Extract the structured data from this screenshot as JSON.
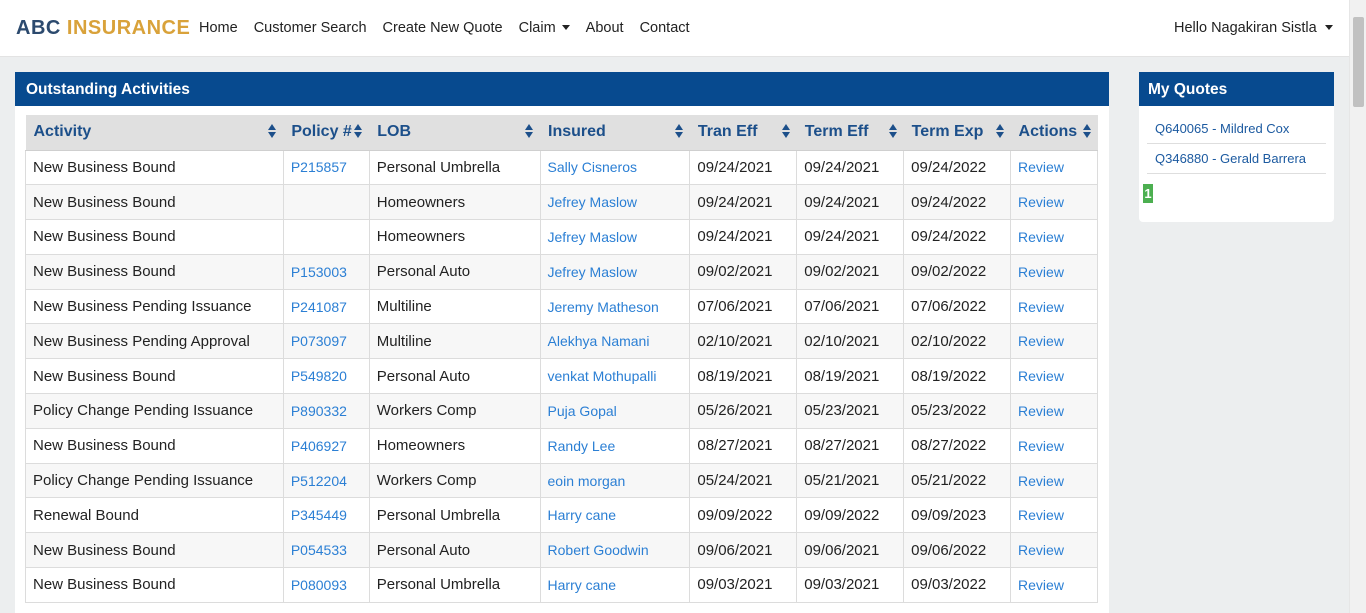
{
  "brand": {
    "part1": "ABC",
    "part2": "INSURANCE"
  },
  "nav": {
    "home": "Home",
    "customer_search": "Customer Search",
    "create_quote": "Create New Quote",
    "claim": "Claim",
    "about": "About",
    "contact": "Contact"
  },
  "user": {
    "greeting": "Hello Nagakiran Sistla"
  },
  "activities": {
    "title": "Outstanding Activities",
    "columns": [
      "Activity",
      "Policy #",
      "LOB",
      "Insured",
      "Tran Eff",
      "Term Eff",
      "Term Exp",
      "Actions"
    ],
    "rows": [
      {
        "activity": "New Business Bound",
        "policy": "P215857",
        "lob": "Personal Umbrella",
        "insured": "Sally Cisneros",
        "tran_eff": "09/24/2021",
        "term_eff": "09/24/2021",
        "term_exp": "09/24/2022",
        "action": "Review"
      },
      {
        "activity": "New Business Bound",
        "policy": "",
        "lob": "Homeowners",
        "insured": "Jefrey Maslow",
        "tran_eff": "09/24/2021",
        "term_eff": "09/24/2021",
        "term_exp": "09/24/2022",
        "action": "Review"
      },
      {
        "activity": "New Business Bound",
        "policy": "",
        "lob": "Homeowners",
        "insured": "Jefrey Maslow",
        "tran_eff": "09/24/2021",
        "term_eff": "09/24/2021",
        "term_exp": "09/24/2022",
        "action": "Review"
      },
      {
        "activity": "New Business Bound",
        "policy": "P153003",
        "lob": "Personal Auto",
        "insured": "Jefrey Maslow",
        "tran_eff": "09/02/2021",
        "term_eff": "09/02/2021",
        "term_exp": "09/02/2022",
        "action": "Review"
      },
      {
        "activity": "New Business Pending Issuance",
        "policy": "P241087",
        "lob": "Multiline",
        "insured": "Jeremy Matheson",
        "tran_eff": "07/06/2021",
        "term_eff": "07/06/2021",
        "term_exp": "07/06/2022",
        "action": "Review"
      },
      {
        "activity": "New Business Pending Approval",
        "policy": "P073097",
        "lob": "Multiline",
        "insured": "Alekhya Namani",
        "tran_eff": "02/10/2021",
        "term_eff": "02/10/2021",
        "term_exp": "02/10/2022",
        "action": "Review"
      },
      {
        "activity": "New Business Bound",
        "policy": "P549820",
        "lob": "Personal Auto",
        "insured": "venkat Mothupalli",
        "tran_eff": "08/19/2021",
        "term_eff": "08/19/2021",
        "term_exp": "08/19/2022",
        "action": "Review"
      },
      {
        "activity": "Policy Change Pending Issuance",
        "policy": "P890332",
        "lob": "Workers Comp",
        "insured": "Puja Gopal",
        "tran_eff": "05/26/2021",
        "term_eff": "05/23/2021",
        "term_exp": "05/23/2022",
        "action": "Review"
      },
      {
        "activity": "New Business Bound",
        "policy": "P406927",
        "lob": "Homeowners",
        "insured": "Randy Lee",
        "tran_eff": "08/27/2021",
        "term_eff": "08/27/2021",
        "term_exp": "08/27/2022",
        "action": "Review"
      },
      {
        "activity": "Policy Change Pending Issuance",
        "policy": "P512204",
        "lob": "Workers Comp",
        "insured": "eoin morgan",
        "tran_eff": "05/24/2021",
        "term_eff": "05/21/2021",
        "term_exp": "05/21/2022",
        "action": "Review"
      },
      {
        "activity": "Renewal Bound",
        "policy": "P345449",
        "lob": "Personal Umbrella",
        "insured": "Harry cane",
        "tran_eff": "09/09/2022",
        "term_eff": "09/09/2022",
        "term_exp": "09/09/2023",
        "action": "Review"
      },
      {
        "activity": "New Business Bound",
        "policy": "P054533",
        "lob": "Personal Auto",
        "insured": "Robert Goodwin",
        "tran_eff": "09/06/2021",
        "term_eff": "09/06/2021",
        "term_exp": "09/06/2022",
        "action": "Review"
      },
      {
        "activity": "New Business Bound",
        "policy": "P080093",
        "lob": "Personal Umbrella",
        "insured": "Harry cane",
        "tran_eff": "09/03/2021",
        "term_eff": "09/03/2021",
        "term_exp": "09/03/2022",
        "action": "Review"
      }
    ]
  },
  "quotes": {
    "title": "My Quotes",
    "items": [
      "Q640065 - Mildred Cox",
      "Q346880 - Gerald Barrera"
    ],
    "page": "1"
  },
  "colors": {
    "header_blue": "#074a8f",
    "link_blue": "#2b7fd4",
    "brand_gold": "#d9a23a",
    "page_green": "#4caf50"
  }
}
